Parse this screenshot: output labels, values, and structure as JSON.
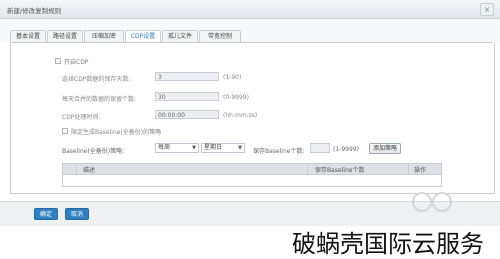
{
  "window": {
    "title": "新建/修改复制规则",
    "close_glyph": "×"
  },
  "tabs": [
    {
      "label": "基本设置"
    },
    {
      "label": "路径设置"
    },
    {
      "label": "压缩加密"
    },
    {
      "label": "CDP设置",
      "active": true
    },
    {
      "label": "孤儿文件"
    },
    {
      "label": "带宽控制"
    }
  ],
  "cdp": {
    "enable_label": "开启CDP",
    "enabled": false,
    "days_label": "选择CDP数据的保存天数:",
    "days_value": "3",
    "days_hint": "(1-90)",
    "count_label": "每天合并的数据的保留个数:",
    "count_value": "30",
    "count_hint": "(0-9999)",
    "time_label": "CDP处理时间:",
    "time_value": "00:00:00",
    "time_hint": "(hh:mm:ss)",
    "baseline_check_label": "限定生成Baseline(全备份)的策略",
    "baseline_label": "Baseline(全备份)策略:",
    "freq_value": "每周",
    "day_value": "星期日",
    "keep_label": "保存Baseline个数:",
    "keep_value": "",
    "keep_hint": "(1-9999)",
    "add_button": "添加策略"
  },
  "table": {
    "headers": [
      "",
      "描述",
      "保存Baseline个数",
      "操作"
    ]
  },
  "footer": {
    "ok": "确定",
    "cancel": "取消"
  },
  "watermark": {
    "text": "破蜗壳国际云服务"
  },
  "colors": {
    "accent": "#2f7fc1",
    "tab_active": "#2f7bc0"
  },
  "icons": {
    "close": "close-icon",
    "dropdown": "chevron-down-icon"
  }
}
